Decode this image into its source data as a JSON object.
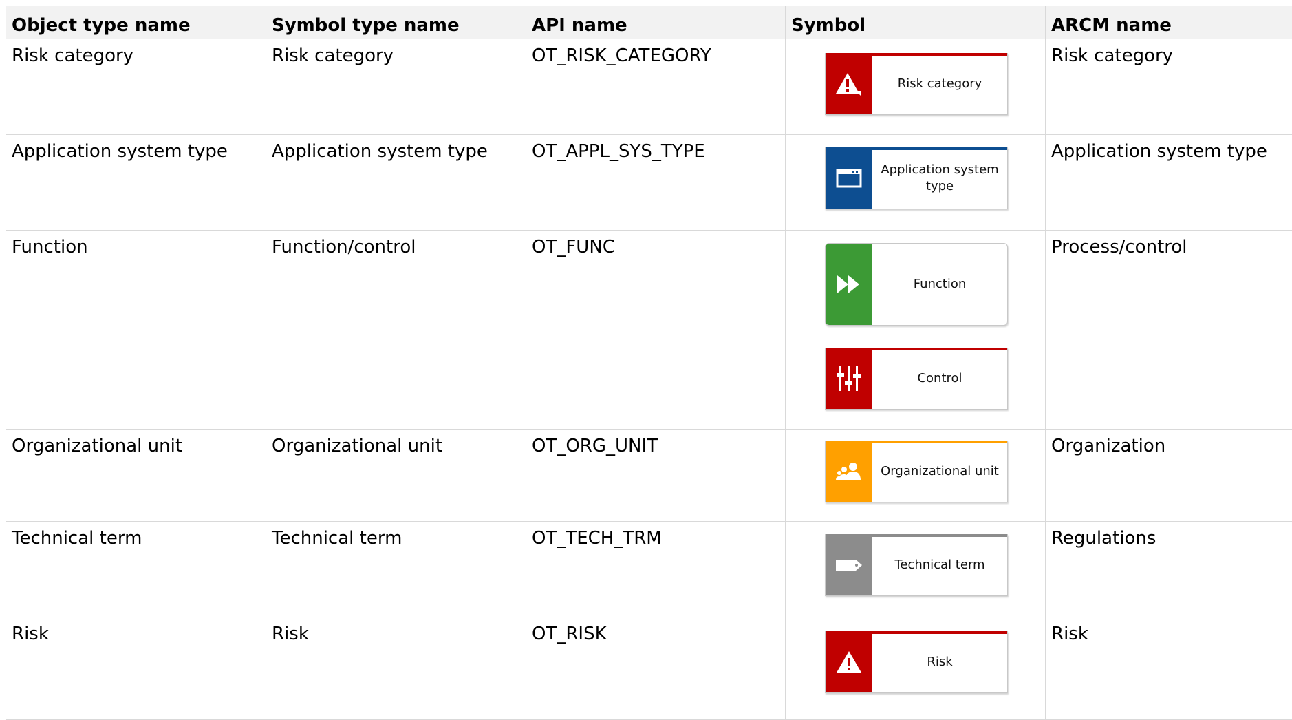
{
  "table": {
    "headers": [
      "Object type name",
      "Symbol type name",
      "API name",
      "Symbol",
      "ARCM name"
    ],
    "rows": [
      {
        "object_type": "Risk category",
        "symbol_type": "Risk category",
        "api_name": "OT_RISK_CATEGORY",
        "symbols": [
          {
            "label": "Risk category",
            "icon": "risk-category-icon",
            "color": "#c00000"
          }
        ],
        "arcm_name": "Risk category"
      },
      {
        "object_type": "Application system type",
        "symbol_type": "Application system type",
        "api_name": "OT_APPL_SYS_TYPE",
        "symbols": [
          {
            "label": "Application system type",
            "icon": "application-window-icon",
            "color": "#0d4e91"
          }
        ],
        "arcm_name": "Application system type"
      },
      {
        "object_type": "Function",
        "symbol_type": "Function/control",
        "api_name": "OT_FUNC",
        "symbols": [
          {
            "label": "Function",
            "icon": "fast-forward-icon",
            "color": "#3c9a35"
          },
          {
            "label": "Control",
            "icon": "control-sliders-icon",
            "color": "#c00000"
          }
        ],
        "arcm_name": "Process/control"
      },
      {
        "object_type": "Organizational unit",
        "symbol_type": "Organizational unit",
        "api_name": "OT_ORG_UNIT",
        "symbols": [
          {
            "label": "Organizational unit",
            "icon": "people-icon",
            "color": "#ffa000"
          }
        ],
        "arcm_name": "Organization"
      },
      {
        "object_type": "Technical term",
        "symbol_type": "Technical term",
        "api_name": "OT_TECH_TRM",
        "symbols": [
          {
            "label": "Technical term",
            "icon": "tag-icon",
            "color": "#8c8c8c"
          }
        ],
        "arcm_name": "Regulations"
      },
      {
        "object_type": "Risk",
        "symbol_type": "Risk",
        "api_name": "OT_RISK",
        "symbols": [
          {
            "label": "Risk",
            "icon": "warning-triangle-icon",
            "color": "#c00000"
          }
        ],
        "arcm_name": "Risk"
      }
    ]
  }
}
